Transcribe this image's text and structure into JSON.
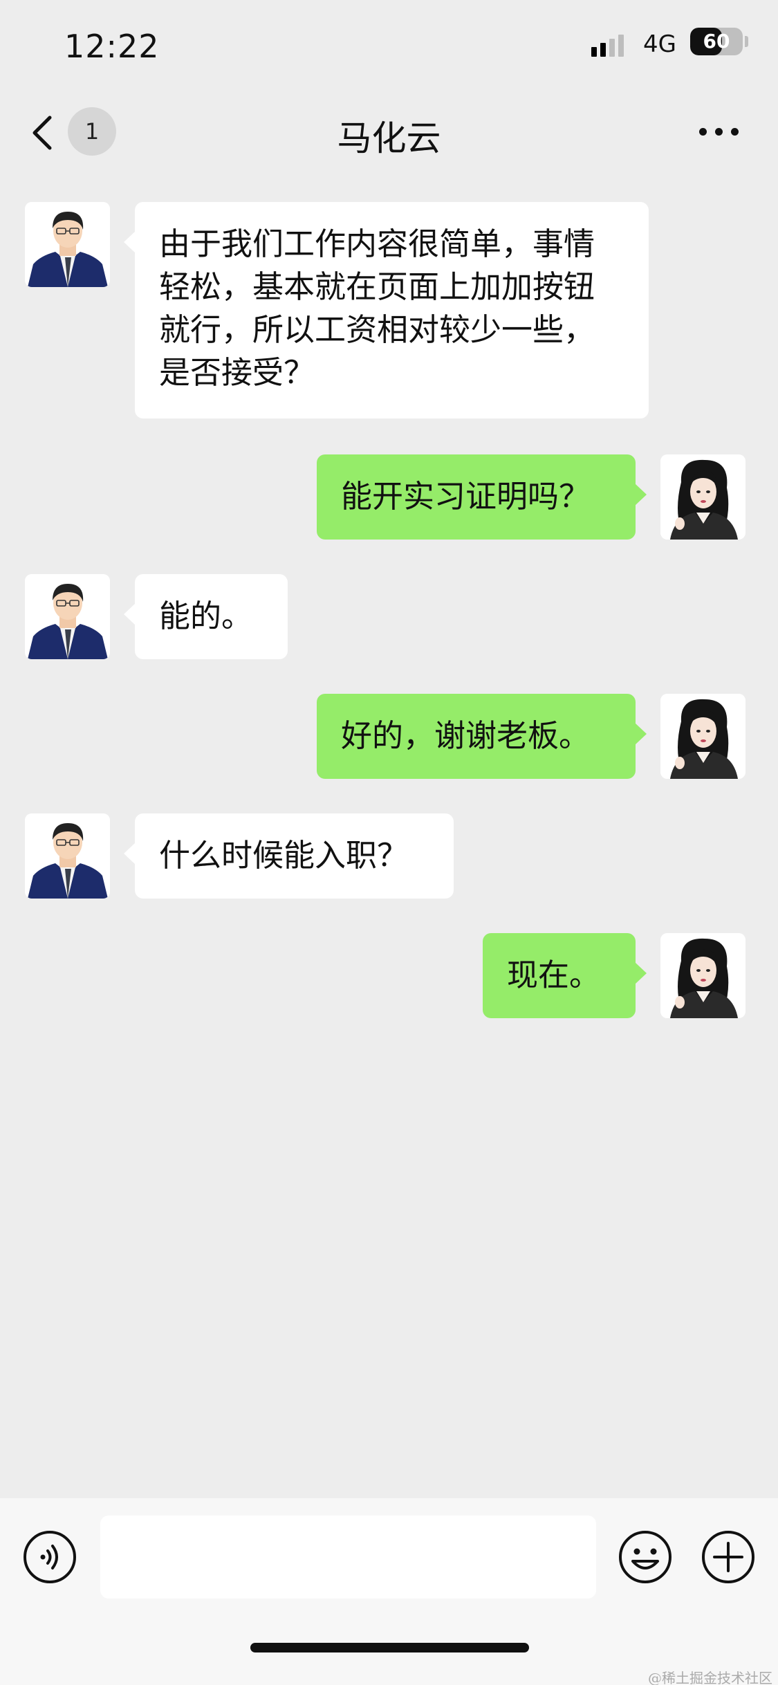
{
  "status_bar": {
    "time": "12:22",
    "network": "4G",
    "battery": "60",
    "battery_level": 0.6
  },
  "nav": {
    "back_icon": "chevron-left-icon",
    "unread_count": "1",
    "title": "马化云",
    "more_icon": "more-horizontal-icon"
  },
  "messages": [
    {
      "side": "left",
      "text": "由于我们工作内容很简单，事情轻松，基本就在页面上加加按钮就行，所以工资相对较少一些，是否接受？"
    },
    {
      "side": "right",
      "text": "能开实习证明吗？"
    },
    {
      "side": "left",
      "text": "能的。"
    },
    {
      "side": "right",
      "text": "好的，谢谢老板。"
    },
    {
      "side": "left",
      "text": "什么时候能入职？"
    },
    {
      "side": "right",
      "text": "现在。"
    }
  ],
  "input_bar": {
    "voice_icon": "voice-icon",
    "text_value": "",
    "emoji_icon": "emoji-icon",
    "plus_icon": "plus-circle-icon"
  },
  "watermark": "@稀土掘金技术社区",
  "colors": {
    "background": "#EDEDED",
    "bubble_left": "#FFFFFF",
    "bubble_right": "#95EC69",
    "input_bar": "#F7F7F7"
  }
}
